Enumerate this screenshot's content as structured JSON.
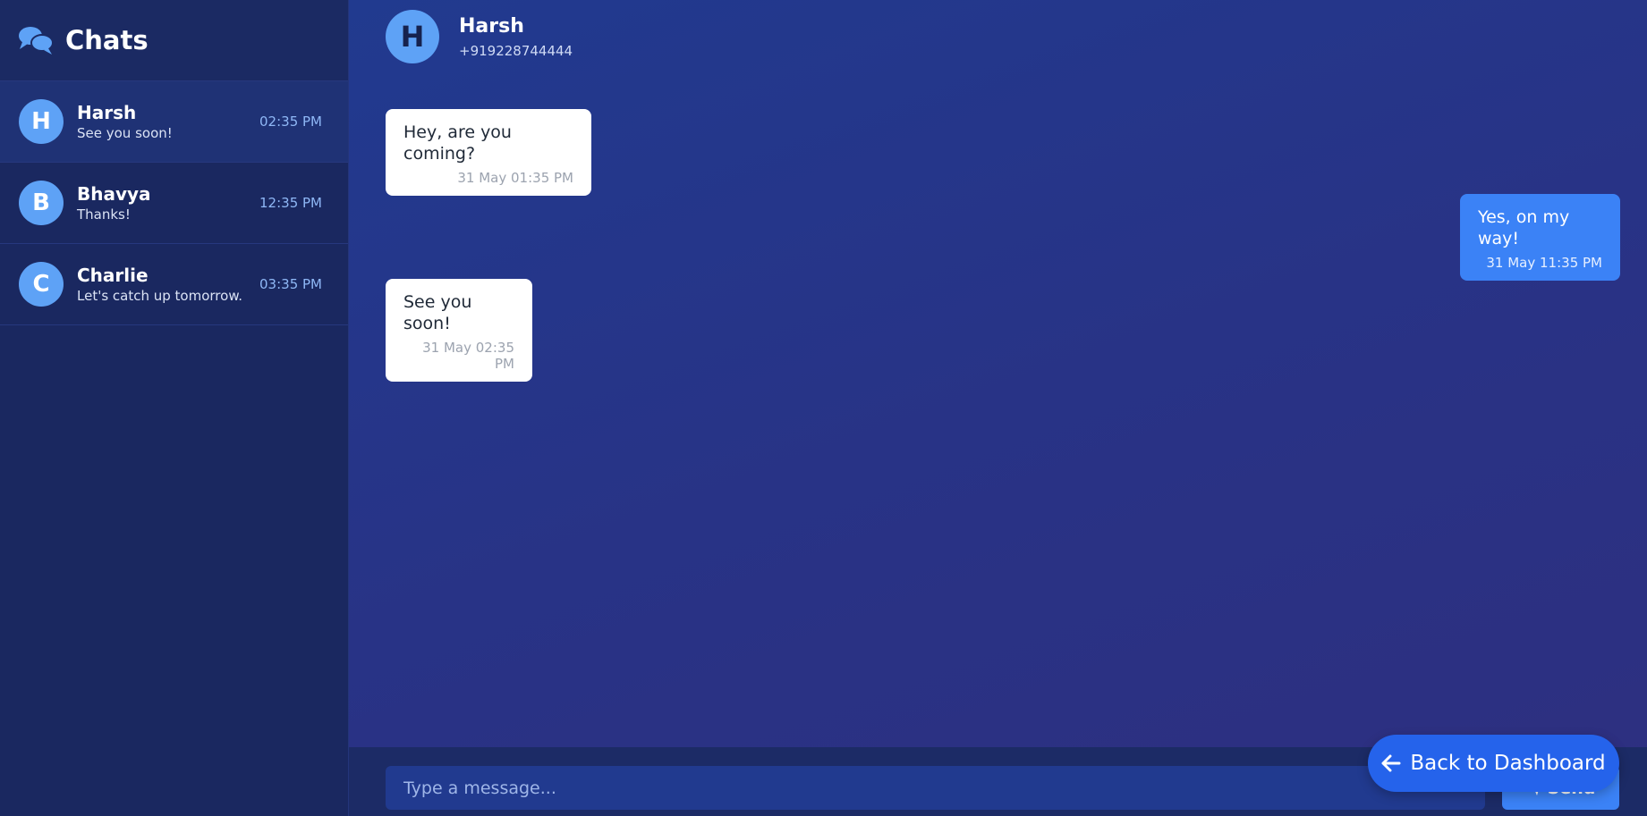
{
  "sidebar": {
    "title": "Chats",
    "items": [
      {
        "initial": "H",
        "name": "Harsh",
        "preview": "See you soon!",
        "time": "02:35 PM"
      },
      {
        "initial": "B",
        "name": "Bhavya",
        "preview": "Thanks!",
        "time": "12:35 PM"
      },
      {
        "initial": "C",
        "name": "Charlie",
        "preview": "Let's catch up tomorrow.",
        "time": "03:35 PM"
      }
    ]
  },
  "header": {
    "initial": "H",
    "name": "Harsh",
    "phone": "+919228744444"
  },
  "messages": [
    {
      "direction": "incoming",
      "text": "Hey, are you coming?",
      "time": "31 May 01:35 PM"
    },
    {
      "direction": "outgoing",
      "text": "Yes, on my way!",
      "time": "31 May 11:35 PM"
    },
    {
      "direction": "incoming",
      "text": "See you soon!",
      "time": "31 May 02:35 PM"
    }
  ],
  "composer": {
    "placeholder": "Type a message...",
    "send_label": "Send"
  },
  "back_label": "Back to Dashboard",
  "colors": {
    "accent": "#3b82f6",
    "avatar": "#5ea2f6",
    "sidebar_bg": "#1a2860",
    "active_item": "#1f3275"
  },
  "icons": {
    "sidebar": "chat-bubbles-icon",
    "send": "paper-plane-icon",
    "back": "arrow-left-icon"
  }
}
